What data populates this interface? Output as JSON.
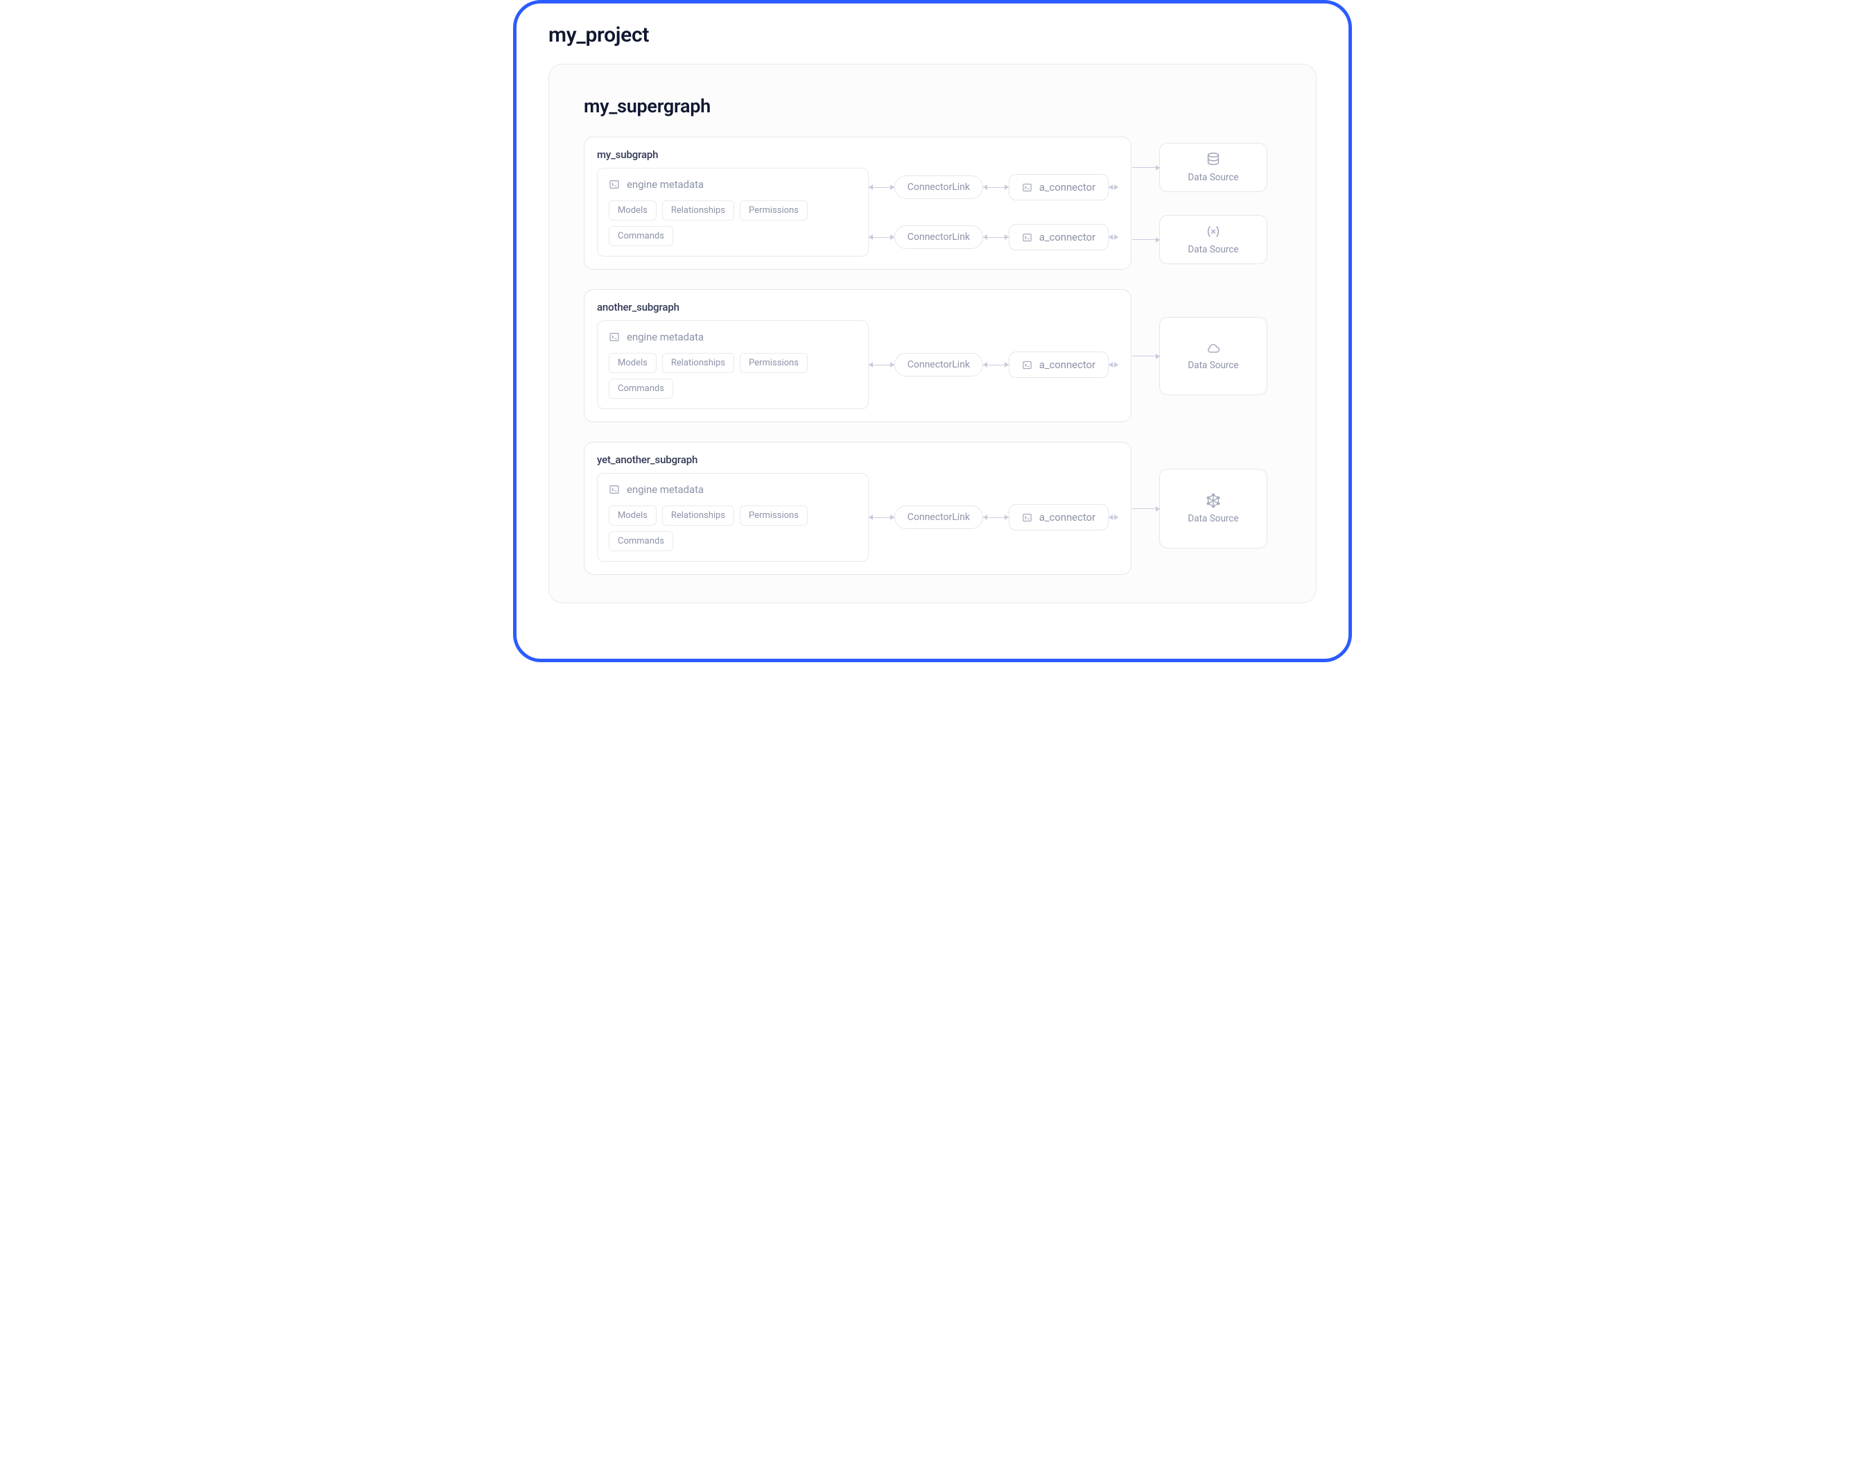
{
  "project": {
    "title": "my_project"
  },
  "supergraph": {
    "title": "my_supergraph",
    "subgraphs": [
      {
        "name": "my_subgraph",
        "engine": {
          "label": "engine metadata",
          "tags": [
            "Models",
            "Relationships",
            "Permissions",
            "Commands"
          ]
        },
        "chains": [
          {
            "link_label": "ConnectorLink",
            "connector_label": "a_connector",
            "datasource": {
              "icon": "database",
              "label": "Data Source"
            }
          },
          {
            "link_label": "ConnectorLink",
            "connector_label": "a_connector",
            "datasource": {
              "icon": "variable",
              "label": "Data Source"
            }
          }
        ]
      },
      {
        "name": "another_subgraph",
        "engine": {
          "label": "engine metadata",
          "tags": [
            "Models",
            "Relationships",
            "Permissions",
            "Commands"
          ]
        },
        "chains": [
          {
            "link_label": "ConnectorLink",
            "connector_label": "a_connector",
            "datasource": {
              "icon": "cloud",
              "label": "Data Source"
            }
          }
        ]
      },
      {
        "name": "yet_another_subgraph",
        "engine": {
          "label": "engine metadata",
          "tags": [
            "Models",
            "Relationships",
            "Permissions",
            "Commands"
          ]
        },
        "chains": [
          {
            "link_label": "ConnectorLink",
            "connector_label": "a_connector",
            "datasource": {
              "icon": "graphql",
              "label": "Data Source"
            }
          }
        ]
      }
    ]
  }
}
